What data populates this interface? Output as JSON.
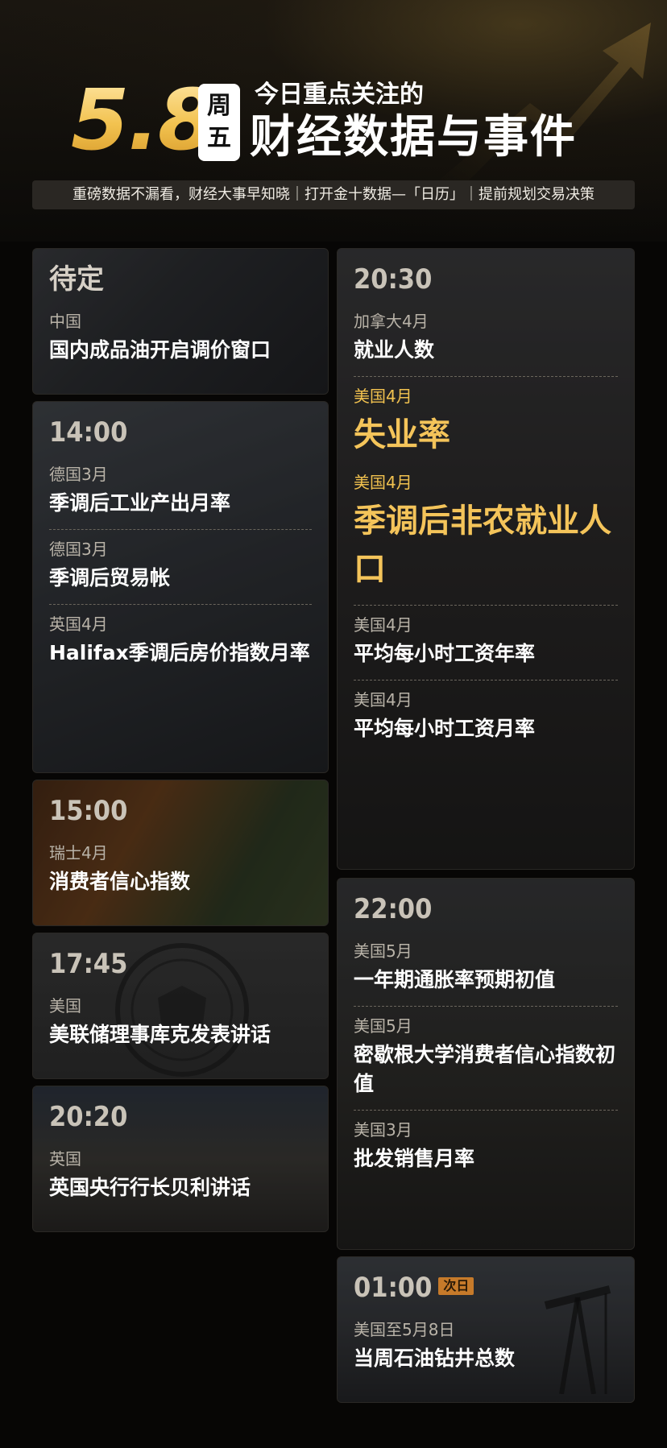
{
  "header": {
    "date": "5.8",
    "weekday_line1": "周",
    "weekday_line2": "五",
    "headline_small": "今日重点关注的",
    "headline_big": "财经数据与事件",
    "subtitle": "重磅数据不漏看，财经大事早知晓｜打开金十数据—「日历」｜提前规划交易决策"
  },
  "colors": {
    "accent_gold": "#f4c45a",
    "next_day_tag": "#c67a2a",
    "background": "#070605"
  },
  "left_cards": [
    {
      "time": "待定",
      "items": [
        {
          "region": "中国",
          "title": "国内成品油开启调价窗口"
        }
      ]
    },
    {
      "time": "14:00",
      "items": [
        {
          "region": "德国3月",
          "title": "季调后工业产出月率"
        },
        {
          "region": "德国3月",
          "title": "季调后贸易帐"
        },
        {
          "region": "英国4月",
          "title": "Halifax季调后房价指数月率"
        }
      ]
    },
    {
      "time": "15:00",
      "items": [
        {
          "region": "瑞士4月",
          "title": "消费者信心指数"
        }
      ]
    },
    {
      "time": "17:45",
      "items": [
        {
          "region": "美国",
          "title": "美联储理事库克发表讲话"
        }
      ]
    },
    {
      "time": "20:20",
      "items": [
        {
          "region": "英国",
          "title": "英国央行行长贝利讲话"
        }
      ]
    }
  ],
  "right_cards": [
    {
      "time": "20:30",
      "items": [
        {
          "region": "加拿大4月",
          "title": "就业人数"
        },
        {
          "region": "美国4月",
          "title": "失业率"
        },
        {
          "region": "美国4月",
          "title": "季调后非农就业人口"
        },
        {
          "region": "美国4月",
          "title": "平均每小时工资年率"
        },
        {
          "region": "美国4月",
          "title": "平均每小时工资月率"
        }
      ]
    },
    {
      "time": "22:00",
      "items": [
        {
          "region": "美国5月",
          "title": "一年期通胀率预期初值"
        },
        {
          "region": "美国5月",
          "title": "密歇根大学消费者信心指数初值"
        },
        {
          "region": "美国3月",
          "title": "批发销售月率"
        }
      ]
    },
    {
      "time": "01:00",
      "tag": "次日",
      "items": [
        {
          "region": "美国至5月8日",
          "title": "当周石油钻井总数"
        }
      ]
    }
  ]
}
